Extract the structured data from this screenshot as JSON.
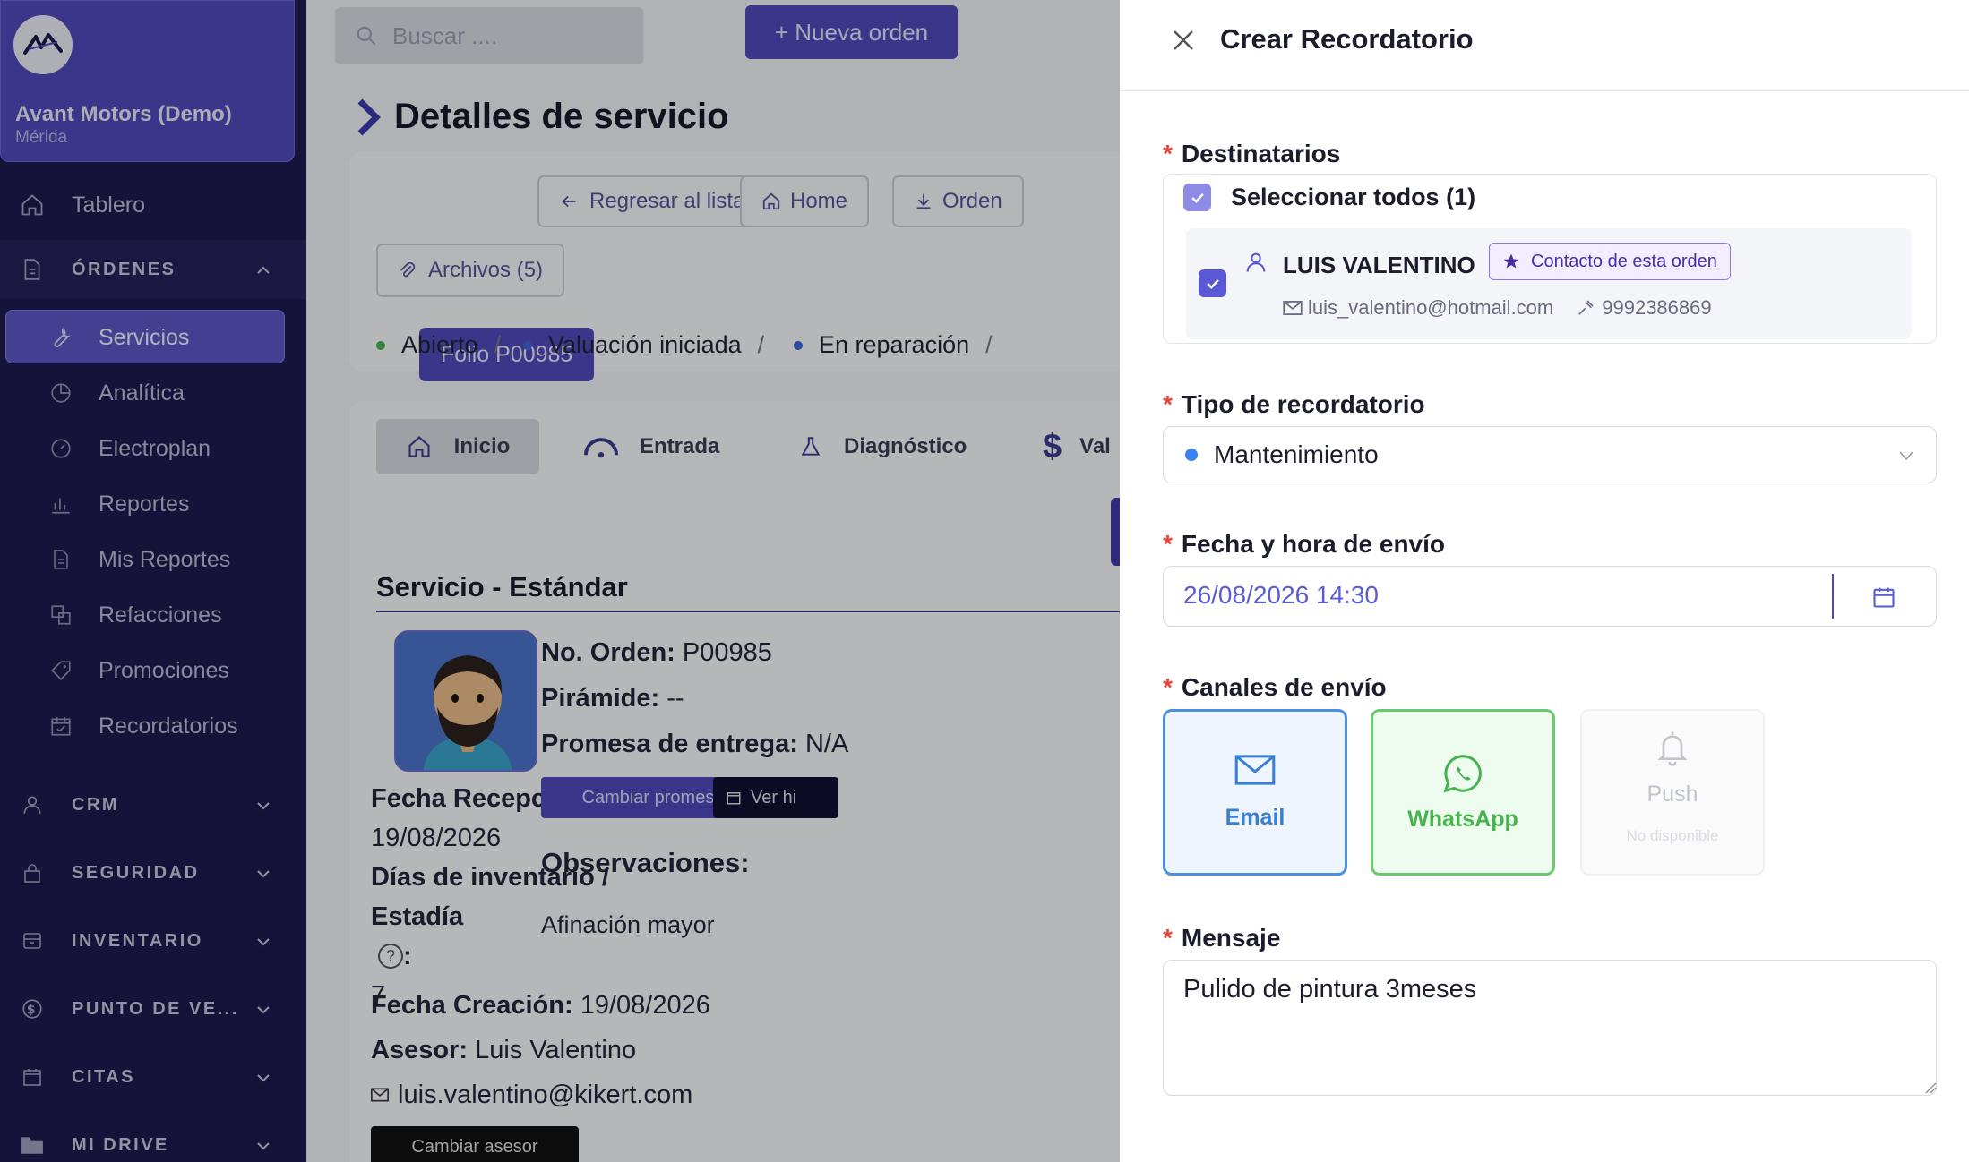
{
  "brand": {
    "name": "Avant Motors (Demo)",
    "city": "Mérida"
  },
  "sidebar": {
    "items": [
      {
        "label": "Tablero"
      },
      {
        "label": "ÓRDENES"
      },
      {
        "label": "Servicios"
      },
      {
        "label": "Analítica"
      },
      {
        "label": "Electroplan"
      },
      {
        "label": "Reportes"
      },
      {
        "label": "Mis Reportes"
      },
      {
        "label": "Refacciones"
      },
      {
        "label": "Promociones"
      },
      {
        "label": "Recordatorios"
      },
      {
        "label": "CRM"
      },
      {
        "label": "SEGURIDAD"
      },
      {
        "label": "INVENTARIO"
      },
      {
        "label": "PUNTO DE VE..."
      },
      {
        "label": "CITAS"
      },
      {
        "label": "MI DRIVE"
      }
    ]
  },
  "topbar": {
    "search_placeholder": "Buscar ....",
    "new_order": "+ Nueva orden"
  },
  "page": {
    "title": "Detalles de servicio",
    "actions": {
      "folio": "Folio P00985",
      "back": "Regresar al listado",
      "home": "Home",
      "order": "Orden",
      "files": "Archivos (5)"
    },
    "breadcrumb": [
      "Abierto",
      "Valuación iniciada",
      "En reparación"
    ],
    "tabs": [
      "Inicio",
      "Entrada",
      "Diagnóstico",
      "Val"
    ],
    "section_title": "Servicio - Estándar",
    "details": {
      "fecha_recepcion_label": "Fecha Recepción:",
      "fecha_recepcion": "19/08/2026",
      "dias_label": "Días de inventario / Estadía",
      "dias_colon": ":",
      "dias": "7",
      "fecha_creacion_label": "Fecha Creación:",
      "fecha_creacion": "19/08/2026",
      "asesor_label": "Asesor:",
      "asesor": "Luis Valentino",
      "asesor_email": "luis.valentino@kikert.com",
      "cambiar_asesor": "Cambiar asesor",
      "no_orden_label": "No. Orden:",
      "no_orden": "P00985",
      "piramide_label": "Pirámide:",
      "piramide": "--",
      "promesa_label": "Promesa de entrega:",
      "promesa": "N/A",
      "cambiar_promesa": "Cambiar promesa",
      "ver_hist": "Ver hi",
      "observaciones_label": "Observaciones:",
      "observaciones": "Afinación mayor"
    }
  },
  "drawer": {
    "title": "Crear Recordatorio",
    "destinatarios": {
      "label": "Destinatarios",
      "select_all": "Seleccionar todos (1)",
      "contact": {
        "name": "LUIS VALENTINO",
        "tag": "Contacto de esta orden",
        "email": "luis_valentino@hotmail.com",
        "phone": "9992386869"
      }
    },
    "tipo": {
      "label": "Tipo de recordatorio",
      "value": "Mantenimiento",
      "dot_color": "#3b82f6"
    },
    "fecha": {
      "label": "Fecha y hora de envío",
      "value": "26/08/2026 14:30"
    },
    "canales": {
      "label": "Canales de envío",
      "email": "Email",
      "whatsapp": "WhatsApp",
      "push": "Push",
      "push_note": "No disponible"
    },
    "mensaje": {
      "label": "Mensaje",
      "value": "Pulido de pintura 3meses"
    }
  }
}
